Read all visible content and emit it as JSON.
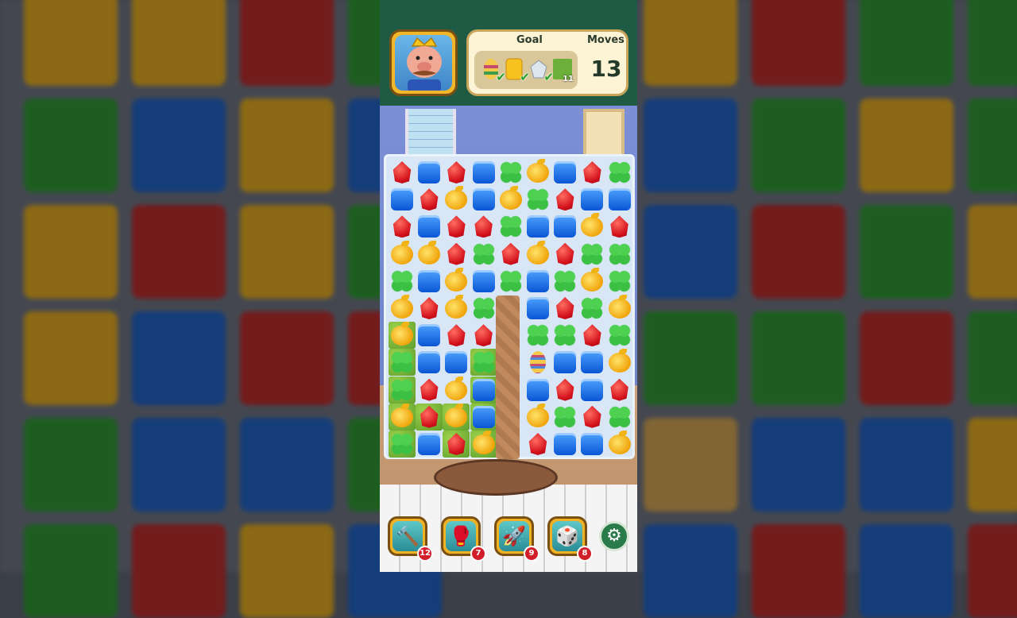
{
  "hud": {
    "goal_label": "Goal",
    "moves_label": "Moves",
    "moves_remaining": "13",
    "goals": [
      {
        "icon": "striped-egg-icon",
        "completed": true
      },
      {
        "icon": "yellow-card-icon",
        "completed": true
      },
      {
        "icon": "silver-gem-icon",
        "completed": true
      },
      {
        "icon": "grass-tile-icon",
        "completed": false,
        "remaining": "11"
      }
    ]
  },
  "board": {
    "rows": [
      [
        "red",
        "blue",
        "red",
        "blue",
        "green",
        "yellow",
        "blue",
        "red",
        "green"
      ],
      [
        "blue",
        "red",
        "yellow",
        "blue",
        "yellow",
        "green",
        "red",
        "blue",
        "blue"
      ],
      [
        "red",
        "blue",
        "red",
        "red",
        "green",
        "blue",
        "blue",
        "yellow",
        "red"
      ],
      [
        "yellow",
        "yellow",
        "red",
        "green",
        "red",
        "yellow",
        "red",
        "green",
        "green"
      ],
      [
        "green",
        "blue",
        "yellow",
        "blue",
        "green",
        "blue",
        "green",
        "yellow",
        "green"
      ],
      [
        "yellow",
        "red",
        "yellow",
        "green",
        "",
        "blue",
        "red",
        "green",
        "yellow"
      ],
      [
        "yellow",
        "blue",
        "red",
        "red",
        "",
        "green",
        "green",
        "red",
        "green"
      ],
      [
        "green",
        "blue",
        "blue",
        "green",
        "",
        "egg",
        "blue",
        "blue",
        "yellow"
      ],
      [
        "green",
        "red",
        "yellow",
        "blue",
        "",
        "blue",
        "red",
        "blue",
        "red"
      ],
      [
        "yellow",
        "red",
        "yellow",
        "blue",
        "",
        "yellow",
        "green",
        "red",
        "green"
      ],
      [
        "green",
        "blue",
        "red",
        "yellow",
        "",
        "red",
        "blue",
        "blue",
        "yellow"
      ]
    ],
    "grass_cells": [
      "6-0",
      "7-0",
      "8-0",
      "9-0",
      "10-0",
      "9-1",
      "9-2",
      "10-2",
      "7-3",
      "8-3",
      "9-3",
      "10-3"
    ]
  },
  "boosters": [
    {
      "name": "hammer",
      "icon": "hammer-icon",
      "count": "12"
    },
    {
      "name": "glove",
      "icon": "boxing-glove-icon",
      "count": "7"
    },
    {
      "name": "rocket",
      "icon": "rocket-icon",
      "count": "9"
    },
    {
      "name": "dice",
      "icon": "dice-icon",
      "count": "8"
    }
  ],
  "colors": {
    "hud_green": "#1f5b44",
    "panel_cream": "#fdf4d6",
    "badge_red": "#d21d2a"
  }
}
